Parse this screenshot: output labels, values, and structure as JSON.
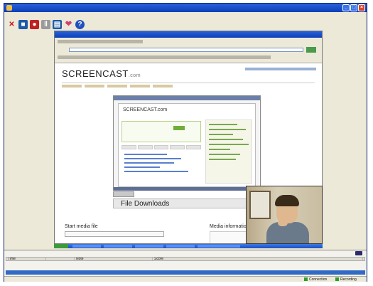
{
  "window": {
    "title": "",
    "controls": [
      "minimize",
      "maximize",
      "close"
    ]
  },
  "menu": [
    "",
    "",
    "",
    "",
    ""
  ],
  "toolbar": {
    "buttons": [
      "close-x-icon",
      "stop-icon",
      "record-icon",
      "pause-icon",
      "marker-icon",
      "favorite-icon",
      "help-icon"
    ]
  },
  "capture": {
    "site_logo_text": "SCREENCAST",
    "site_logo_suffix": ".com",
    "inner_logo": "SCREENCAST.com",
    "file_downloads_label": "File Downloads",
    "start_media_label": "Start media file",
    "media_info_label": "Media information"
  },
  "logger": {
    "heading": "",
    "columns": [
      "Time",
      "",
      "Note",
      "Score"
    ],
    "rows": [
      {
        "time": "",
        "type": "",
        "note": "",
        "selected": false
      },
      {
        "time": "",
        "type": "",
        "note": "",
        "selected": false
      },
      {
        "time": "",
        "type": "",
        "note": "",
        "selected": true
      }
    ]
  },
  "status": {
    "left": "",
    "center": "",
    "observer": "",
    "connection": "Connection",
    "recording": "Recording"
  },
  "colors": {
    "title_blue": "#0a3fb8",
    "selection_blue": "#316ac5",
    "led_green": "#2aa02a"
  }
}
